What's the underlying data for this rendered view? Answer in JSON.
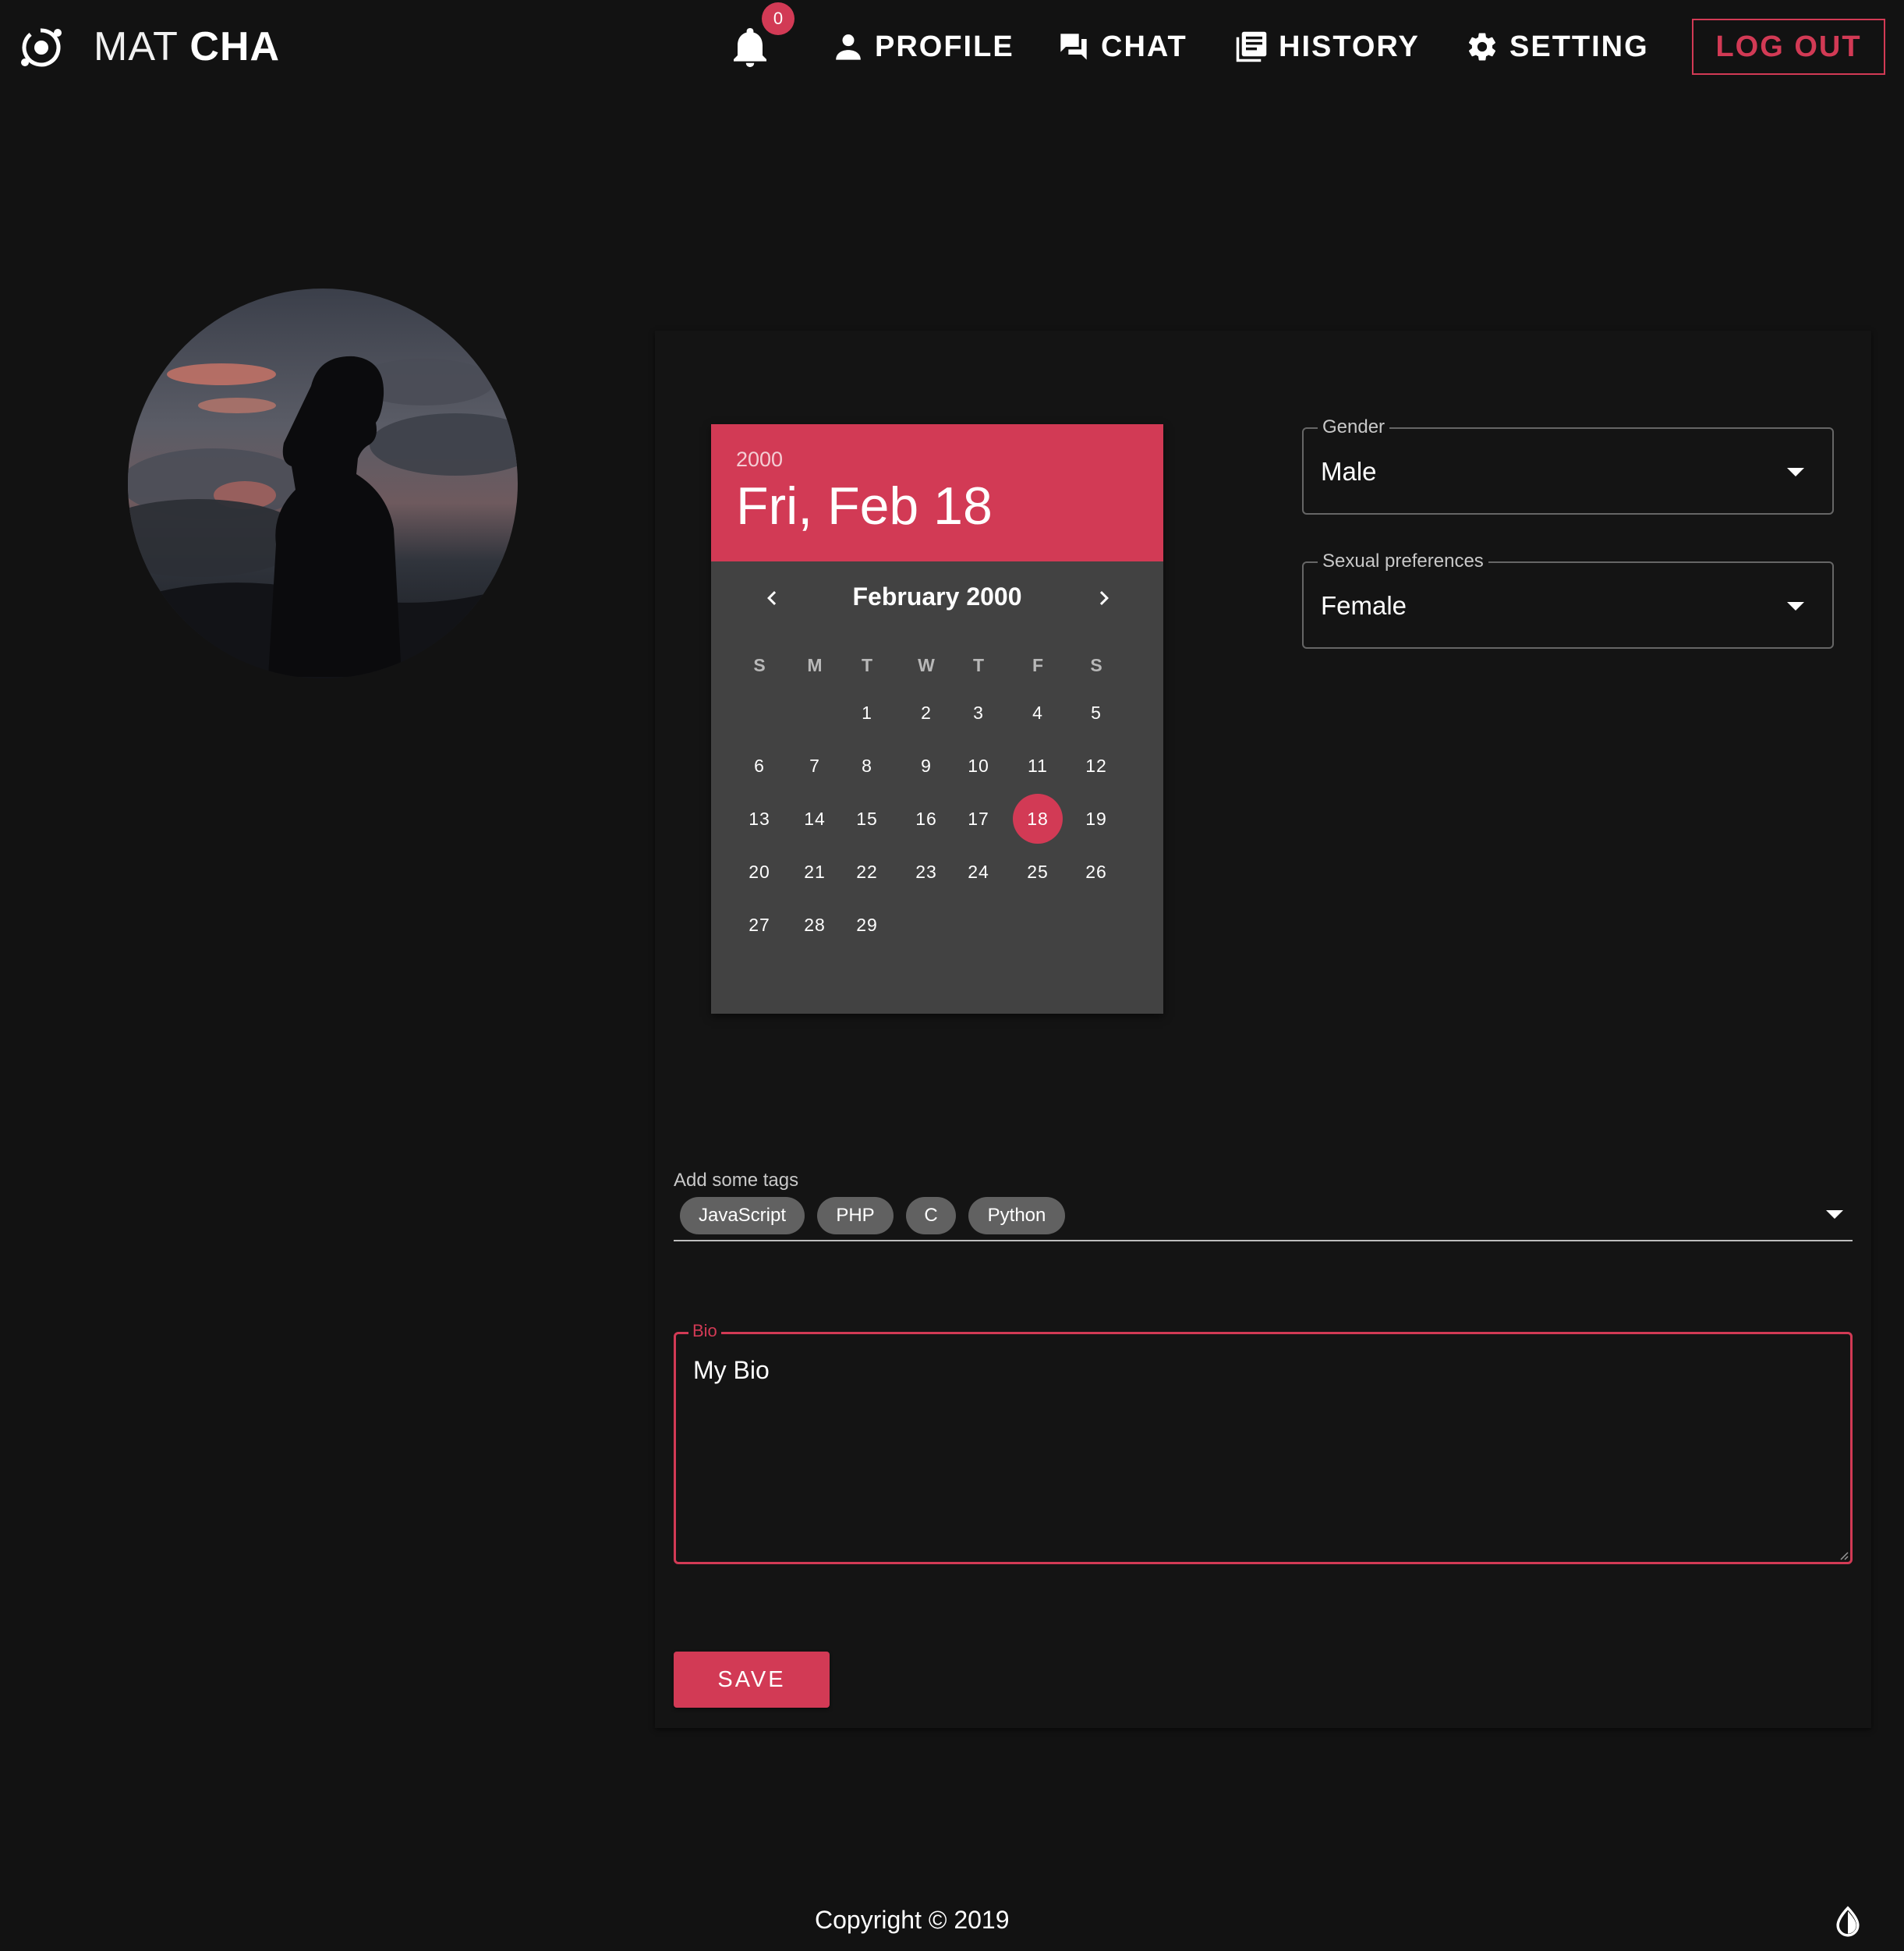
{
  "app": {
    "brand_thin": "MAT",
    "brand_bold": "CHA",
    "notification_count": "0"
  },
  "nav": {
    "profile": "PROFILE",
    "chat": "CHAT",
    "history": "HISTORY",
    "setting": "SETTING",
    "logout": "LOG OUT"
  },
  "colors": {
    "accent": "#d23a55",
    "background": "#121212",
    "calendar_body": "#424242",
    "chip": "#616161"
  },
  "calendar": {
    "year": "2000",
    "selected_label": "Fri, Feb 18",
    "month_label": "February 2000",
    "weekdays": [
      "S",
      "M",
      "T",
      "W",
      "T",
      "F",
      "S"
    ],
    "first_weekday_index": 2,
    "days_in_month": 29,
    "selected_day": 18
  },
  "gender": {
    "label": "Gender",
    "value": "Male"
  },
  "sexual_preferences": {
    "label": "Sexual preferences",
    "value": "Female"
  },
  "tags": {
    "label": "Add some tags",
    "items": [
      "JavaScript",
      "PHP",
      "C",
      "Python"
    ]
  },
  "bio": {
    "label": "Bio",
    "value": "My Bio"
  },
  "save_label": "SAVE",
  "footer": {
    "copyright": "Copyright © 2019"
  }
}
